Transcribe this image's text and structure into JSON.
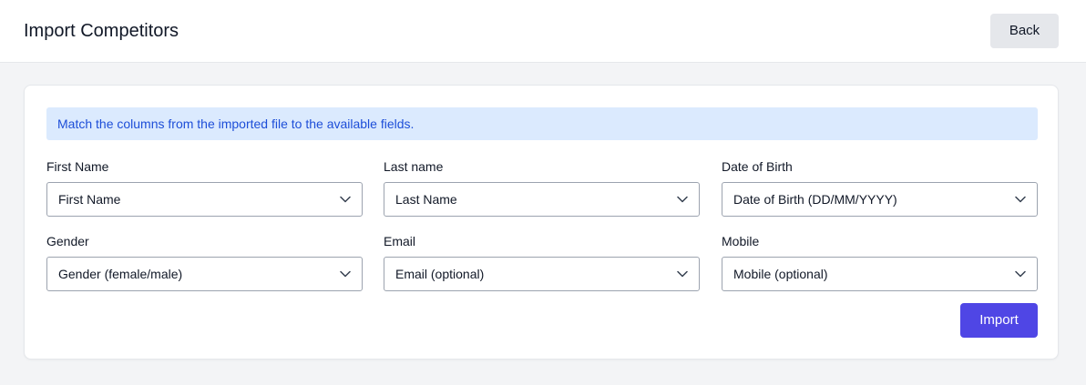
{
  "header": {
    "title": "Import Competitors",
    "back_label": "Back"
  },
  "banner": {
    "text": "Match the columns from the imported file to the available fields."
  },
  "fields": [
    {
      "label": "First Name",
      "value": "First Name"
    },
    {
      "label": "Last name",
      "value": "Last Name"
    },
    {
      "label": "Date of Birth",
      "value": "Date of Birth (DD/MM/YYYY)"
    },
    {
      "label": "Gender",
      "value": "Gender (female/male)"
    },
    {
      "label": "Email",
      "value": "Email (optional)"
    },
    {
      "label": "Mobile",
      "value": "Mobile (optional)"
    }
  ],
  "actions": {
    "import_label": "Import"
  },
  "colors": {
    "accent": "#4f46e5",
    "banner_bg": "#dbeafe",
    "banner_text": "#1d4ed8"
  }
}
